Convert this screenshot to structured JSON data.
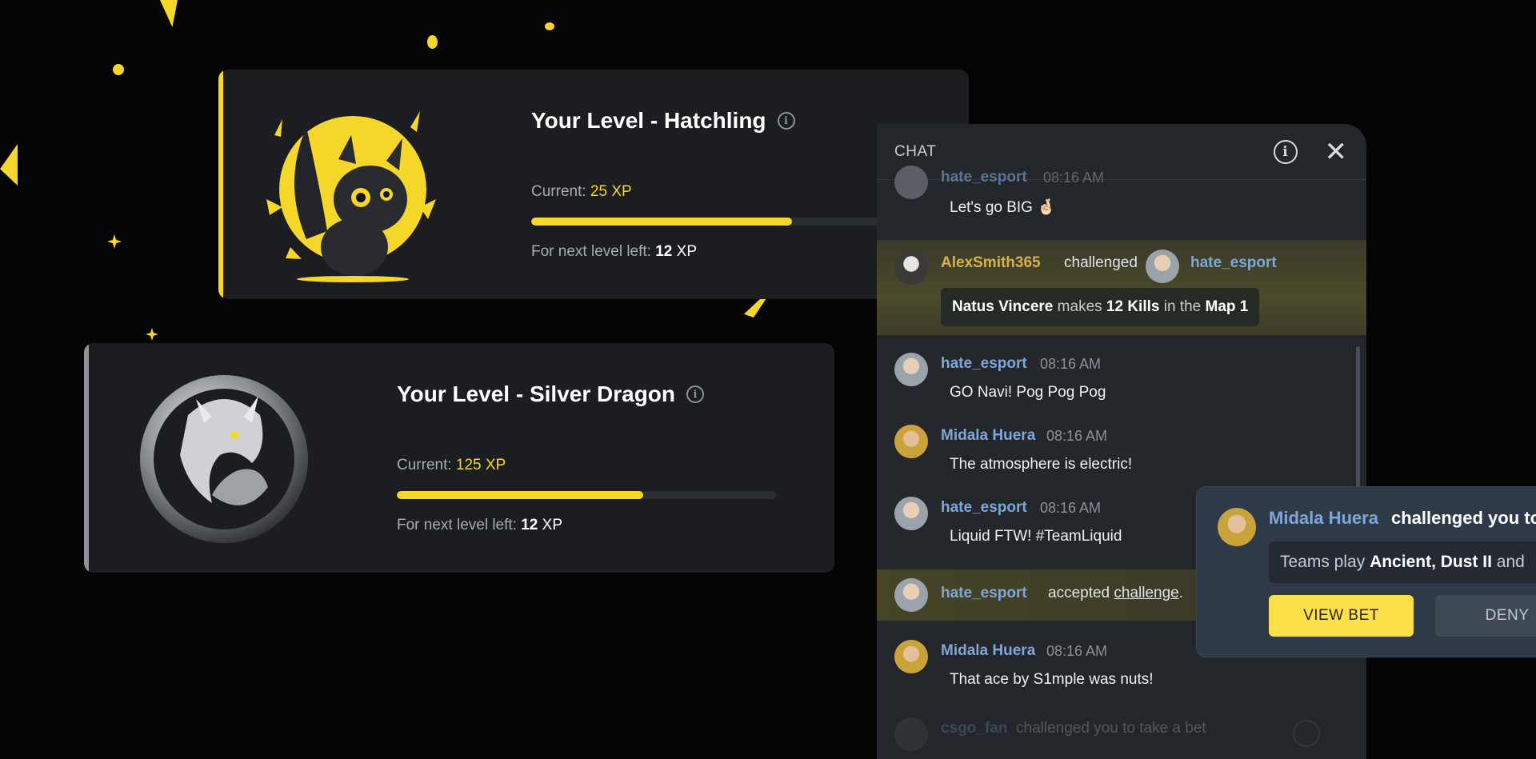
{
  "hatchling_card": {
    "title": "Your Level - Hatchling",
    "current_label": "Current:",
    "current_value": "25",
    "current_unit": "XP",
    "progress": 0.68,
    "next_label": "For next level left:",
    "next_value": "12",
    "next_unit": "XP",
    "image": "hatchling-dragon-emblem"
  },
  "silver_card": {
    "title": "Your Level - Silver Dragon",
    "current_label": "Current:",
    "current_value": "125",
    "current_unit": "XP",
    "progress": 0.65,
    "next_label": "For next level left:",
    "next_value": "12",
    "next_unit": "XP",
    "image": "silver-dragon-emblem"
  },
  "chat": {
    "title": "CHAT",
    "info_icon": "info-icon",
    "close_icon": "close-icon",
    "messages": [
      {
        "user": "hate_esport",
        "time": "08:16 AM",
        "text": "Let's go BIG 🤞🏻"
      },
      {
        "challenger": "AlexSmith365",
        "verb": "challenged",
        "target": "hate_esport",
        "bet": {
          "team": "Natus Vincere",
          "makes": "makes",
          "count": "12 Kills",
          "in": "in the",
          "map": "Map 1"
        }
      },
      {
        "user": "hate_esport",
        "time": "08:16 AM",
        "text": "GO Navi! Pog Pog Pog"
      },
      {
        "user": "Midala Huera",
        "time": "08:16 AM",
        "text": "The atmosphere is electric!"
      },
      {
        "user": "hate_esport",
        "time": "08:16 AM",
        "text": "Liquid FTW! #TeamLiquid"
      },
      {
        "user": "hate_esport",
        "accepted": "accepted",
        "link": "challenge",
        "punct": "."
      },
      {
        "user": "Midala Huera",
        "time": "08:16 AM",
        "text": "That ace by S1mple was nuts!"
      },
      {
        "user": "csgo_fan",
        "text": "challenged you to take a bet"
      }
    ],
    "colors": {
      "accent": "#f5d72a",
      "username_blue": "#7fa6d8",
      "username_gold": "#d6b24a"
    }
  },
  "popup": {
    "user": "Midala Huera",
    "text": "challenged you to",
    "bet_prefix": "Teams play",
    "bet_maps": "Ancient, Dust II",
    "bet_suffix": "and",
    "view_label": "VIEW BET",
    "deny_label": "DENY"
  }
}
